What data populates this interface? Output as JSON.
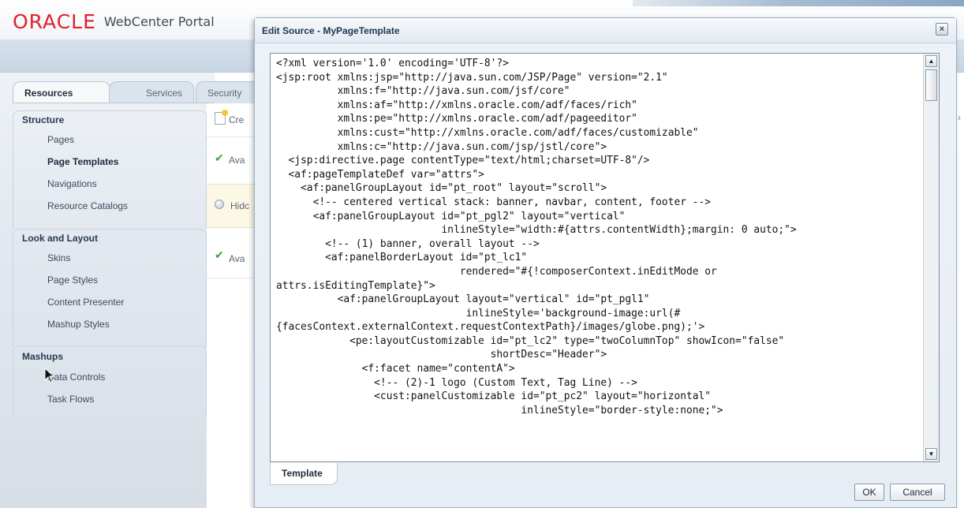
{
  "portal": {
    "logo_text": "ORACLE",
    "product": "WebCenter Portal"
  },
  "tabs": [
    {
      "label": "Resources",
      "active": true
    },
    {
      "label": "Services",
      "active": false
    },
    {
      "label": "Security",
      "active": false
    }
  ],
  "sidebar": {
    "structure": {
      "heading": "Structure",
      "items": [
        "Pages",
        "Page Templates",
        "Navigations",
        "Resource Catalogs"
      ]
    },
    "look_layout": {
      "heading": "Look and Layout",
      "items": [
        "Skins",
        "Page Styles",
        "Content Presenter",
        "Mashup Styles"
      ]
    },
    "mashups": {
      "heading": "Mashups",
      "items": [
        "Data Controls",
        "Task Flows"
      ]
    }
  },
  "middle": {
    "create_label": "Cre",
    "row1_label": "Ava",
    "row2_label": "Hidc",
    "row3_label": "Ava"
  },
  "dialog": {
    "title": "Edit Source - MyPageTemplate",
    "close_icon": "×",
    "bottom_tab": "Template",
    "ok_label": "OK",
    "cancel_label": "Cancel",
    "code_lines": [
      "<?xml version='1.0' encoding='UTF-8'?>",
      "<jsp:root xmlns:jsp=\"http://java.sun.com/JSP/Page\" version=\"2.1\"",
      "          xmlns:f=\"http://java.sun.com/jsf/core\"",
      "          xmlns:af=\"http://xmlns.oracle.com/adf/faces/rich\"",
      "          xmlns:pe=\"http://xmlns.oracle.com/adf/pageeditor\"",
      "          xmlns:cust=\"http://xmlns.oracle.com/adf/faces/customizable\"",
      "          xmlns:c=\"http://java.sun.com/jsp/jstl/core\">",
      "  <jsp:directive.page contentType=\"text/html;charset=UTF-8\"/>",
      "  <af:pageTemplateDef var=\"attrs\">",
      "    <af:panelGroupLayout id=\"pt_root\" layout=\"scroll\">",
      "      <!-- centered vertical stack: banner, navbar, content, footer -->",
      "      <af:panelGroupLayout id=\"pt_pgl2\" layout=\"vertical\"",
      "                           inlineStyle=\"width:#{attrs.contentWidth};margin: 0 auto;\">",
      "        <!-- (1) banner, overall layout -->",
      "        <af:panelBorderLayout id=\"pt_lc1\"",
      "                              rendered=\"#{!composerContext.inEditMode or",
      "attrs.isEditingTemplate}\">",
      "          <af:panelGroupLayout layout=\"vertical\" id=\"pt_pgl1\"",
      "                               inlineStyle='background-image:url(#",
      "{facesContext.externalContext.requestContextPath}/images/globe.png);'>",
      "            <pe:layoutCustomizable id=\"pt_lc2\" type=\"twoColumnTop\" showIcon=\"false\"",
      "                                   shortDesc=\"Header\">",
      "              <f:facet name=\"contentA\">",
      "                <!-- (2)-1 logo (Custom Text, Tag Line) -->",
      "                <cust:panelCustomizable id=\"pt_pc2\" layout=\"horizontal\"",
      "                                        inlineStyle=\"border-style:none;\">"
    ]
  }
}
